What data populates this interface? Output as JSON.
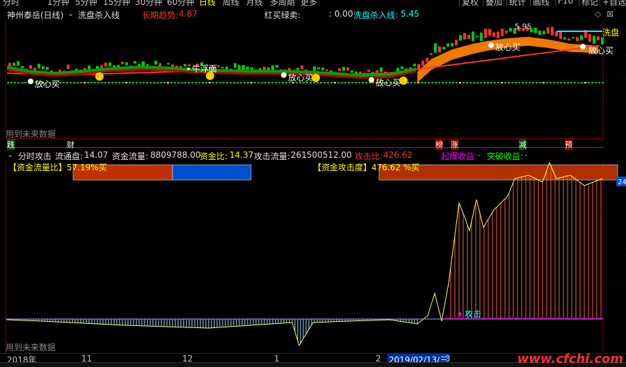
{
  "toolbar": {
    "tabs": [
      "分时",
      "1分钟",
      "5分钟",
      "15分钟",
      "30分钟",
      "60分钟",
      "日线",
      "周线",
      "月线",
      "多周期",
      "更多"
    ],
    "active_tab": "日线",
    "right_buttons": [
      "复权",
      "叠加",
      "统计",
      "画线",
      "F10",
      "标记",
      "+自选"
    ]
  },
  "main_panel": {
    "title": "神州泰岳(日线)",
    "indicator_name": "洗盘杀入线",
    "long_trend_label": "长期趋势:",
    "long_trend_value": "4.87",
    "buy_sell_label": "红买绿卖:",
    "buy_sell_value": ": 0.00",
    "wash_line_label": "洗盘杀入线:",
    "wash_line_value": "5.45",
    "price_annotation": "5.95",
    "right_label_wash": "洗盘",
    "right_label_buy": "放心买",
    "annotations": {
      "fangxin_mai": "放心买",
      "niu_fu_mian": "牛浮面"
    },
    "future_note": "用到未来数据",
    "colors": {
      "trend_line": "#ff3030",
      "band": "#ff8000",
      "cyan_line": "#00ffff",
      "up_candle": "#00cc00",
      "down_candle": "#ff3030",
      "dotted_base": "#00cc00"
    }
  },
  "signal_bar": {
    "items": [
      "践",
      "财",
      "榜",
      "涨",
      "减",
      "预"
    ]
  },
  "sub_panel": {
    "indicator": "分时攻击",
    "float_label": "流通盘:",
    "float_value": "14.07",
    "fund_flow_label": "资金流量:",
    "fund_flow_value": "8809788.00",
    "fund_ratio_label": "资金比:",
    "fund_ratio_value": "14.37",
    "attack_flow_label": "攻击流量:",
    "attack_flow_value": "261500512.00",
    "attack_ratio_label": "攻击比:",
    "attack_ratio_value": "426.62",
    "explode_label": "起爆收益:",
    "explode_value": "-",
    "breakout_label": "突破收益:",
    "breakout_value": "-",
    "fund_flow_ratio_text": "【资金流量比】57.19%买",
    "fund_attack_text": "【资金攻击度】476.62 %买",
    "attack_marker": "攻击",
    "right_axis_value": "24",
    "future_note": "用到未来数据"
  },
  "date_axis": {
    "labels": [
      "2018年",
      "11",
      "12",
      "1",
      "2",
      "3"
    ],
    "highlight_date": "2019/02/13/三"
  },
  "watermark": "www.cfchi.com"
}
